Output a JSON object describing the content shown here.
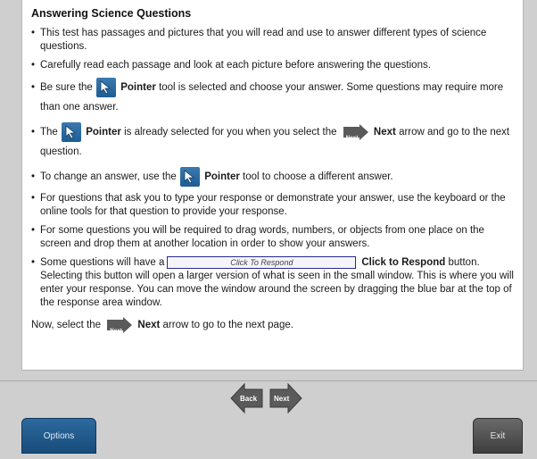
{
  "content": {
    "title": "Answering Science Questions",
    "bullet_char": "•",
    "b1": "This test has passages and pictures that you will read and use to answer different types of science questions.",
    "b2": "Carefully read each passage and look at each picture before answering the questions.",
    "b3_pre": "Be sure the",
    "b3_bold": "Pointer",
    "b3_post": "tool is selected and choose your answer. Some questions may require more than one answer.",
    "b4_pre": "The",
    "b4_bold1": "Pointer",
    "b4_mid": "is already selected for you when you select the",
    "b4_bold2": "Next",
    "b4_post": "arrow and go to the next question.",
    "b5_pre": "To change an answer, use the",
    "b5_bold": "Pointer",
    "b5_post": "tool to choose a different answer.",
    "b6": "For questions that ask you to type your response or demonstrate your answer, use the keyboard or the online tools for that question to provide your response.",
    "b7": "For some questions you will be required to drag words, numbers, or objects from one place on the screen and drop them at another location in order to show your answers.",
    "b8_pre": "Some questions will have a",
    "b8_button_text": "Click To Respond",
    "b8_bold": "Click to Respond",
    "b8_post": "button. Selecting this button will open a larger version of what is seen in the small window. This is where you will enter your response. You can move the window around the screen by dragging the blue bar at the top of the response area window.",
    "last_pre": "Now, select the",
    "last_bold": "Next",
    "last_post": "arrow to go to the next page.",
    "next_icon_label": "Next"
  },
  "icons": {
    "pointer": "pointer-arrow-icon",
    "next": "next-arrow-icon"
  },
  "colors": {
    "pointer_bg": "#2a6aa3",
    "nav_arrow": "#5a5a5a",
    "options_bg": "#1f5a8c",
    "exit_bg": "#4a4a4a"
  },
  "footer": {
    "back_label": "Back",
    "next_label": "Next",
    "options_label": "Options",
    "exit_label": "Exit"
  }
}
